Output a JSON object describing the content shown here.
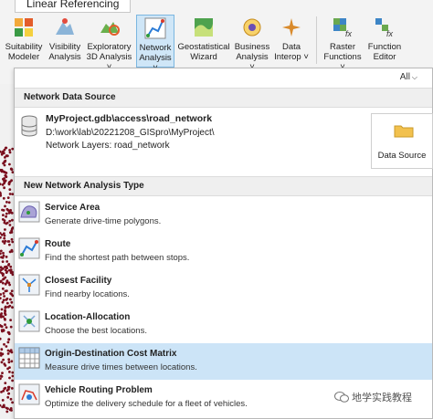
{
  "ribbon": {
    "tab_label": "Linear Referencing",
    "buttons": [
      {
        "name": "suitability-modeler-button",
        "label": "Suitability\nModeler"
      },
      {
        "name": "visibility-analysis-button",
        "label": "Visibility\nAnalysis"
      },
      {
        "name": "exploratory-3d-button",
        "label": "Exploratory\n3D Analysis ˅"
      },
      {
        "name": "network-analysis-button",
        "label": "Network\nAnalysis ˅"
      },
      {
        "name": "geostatistical-wizard-button",
        "label": "Geostatistical\nWizard"
      },
      {
        "name": "business-analysis-button",
        "label": "Business\nAnalysis ˅"
      },
      {
        "name": "data-interop-button",
        "label": "Data\nInterop ˅"
      },
      {
        "name": "raster-functions-button",
        "label": "Raster\nFunctions ˅"
      },
      {
        "name": "function-editor-button",
        "label": "Function\nEditor"
      }
    ]
  },
  "panel": {
    "filter": "All",
    "network_source": {
      "header": "Network Data Source",
      "name": "MyProject.gdb\\access\\road_network",
      "path": "D:\\work\\lab\\20221208_GISpro\\MyProject\\",
      "layers": "Network Layers: road_network",
      "data_source_label": "Data Source"
    },
    "analysis_header": "New Network Analysis Type",
    "items": [
      {
        "name": "Service Area",
        "desc": "Generate drive-time polygons."
      },
      {
        "name": "Route",
        "desc": "Find the shortest path between stops."
      },
      {
        "name": "Closest Facility",
        "desc": "Find nearby locations."
      },
      {
        "name": "Location-Allocation",
        "desc": "Choose the best locations."
      },
      {
        "name": "Origin-Destination Cost Matrix",
        "desc": "Measure drive times between locations."
      },
      {
        "name": "Vehicle Routing Problem",
        "desc": "Optimize the delivery schedule for a fleet of vehicles."
      }
    ],
    "selected_index": 4
  },
  "watermark": "地学实践教程",
  "colors": {
    "accent": "#cce4f7",
    "active_button": "#cfe6f7",
    "map_dots": "#7a0f1e"
  }
}
